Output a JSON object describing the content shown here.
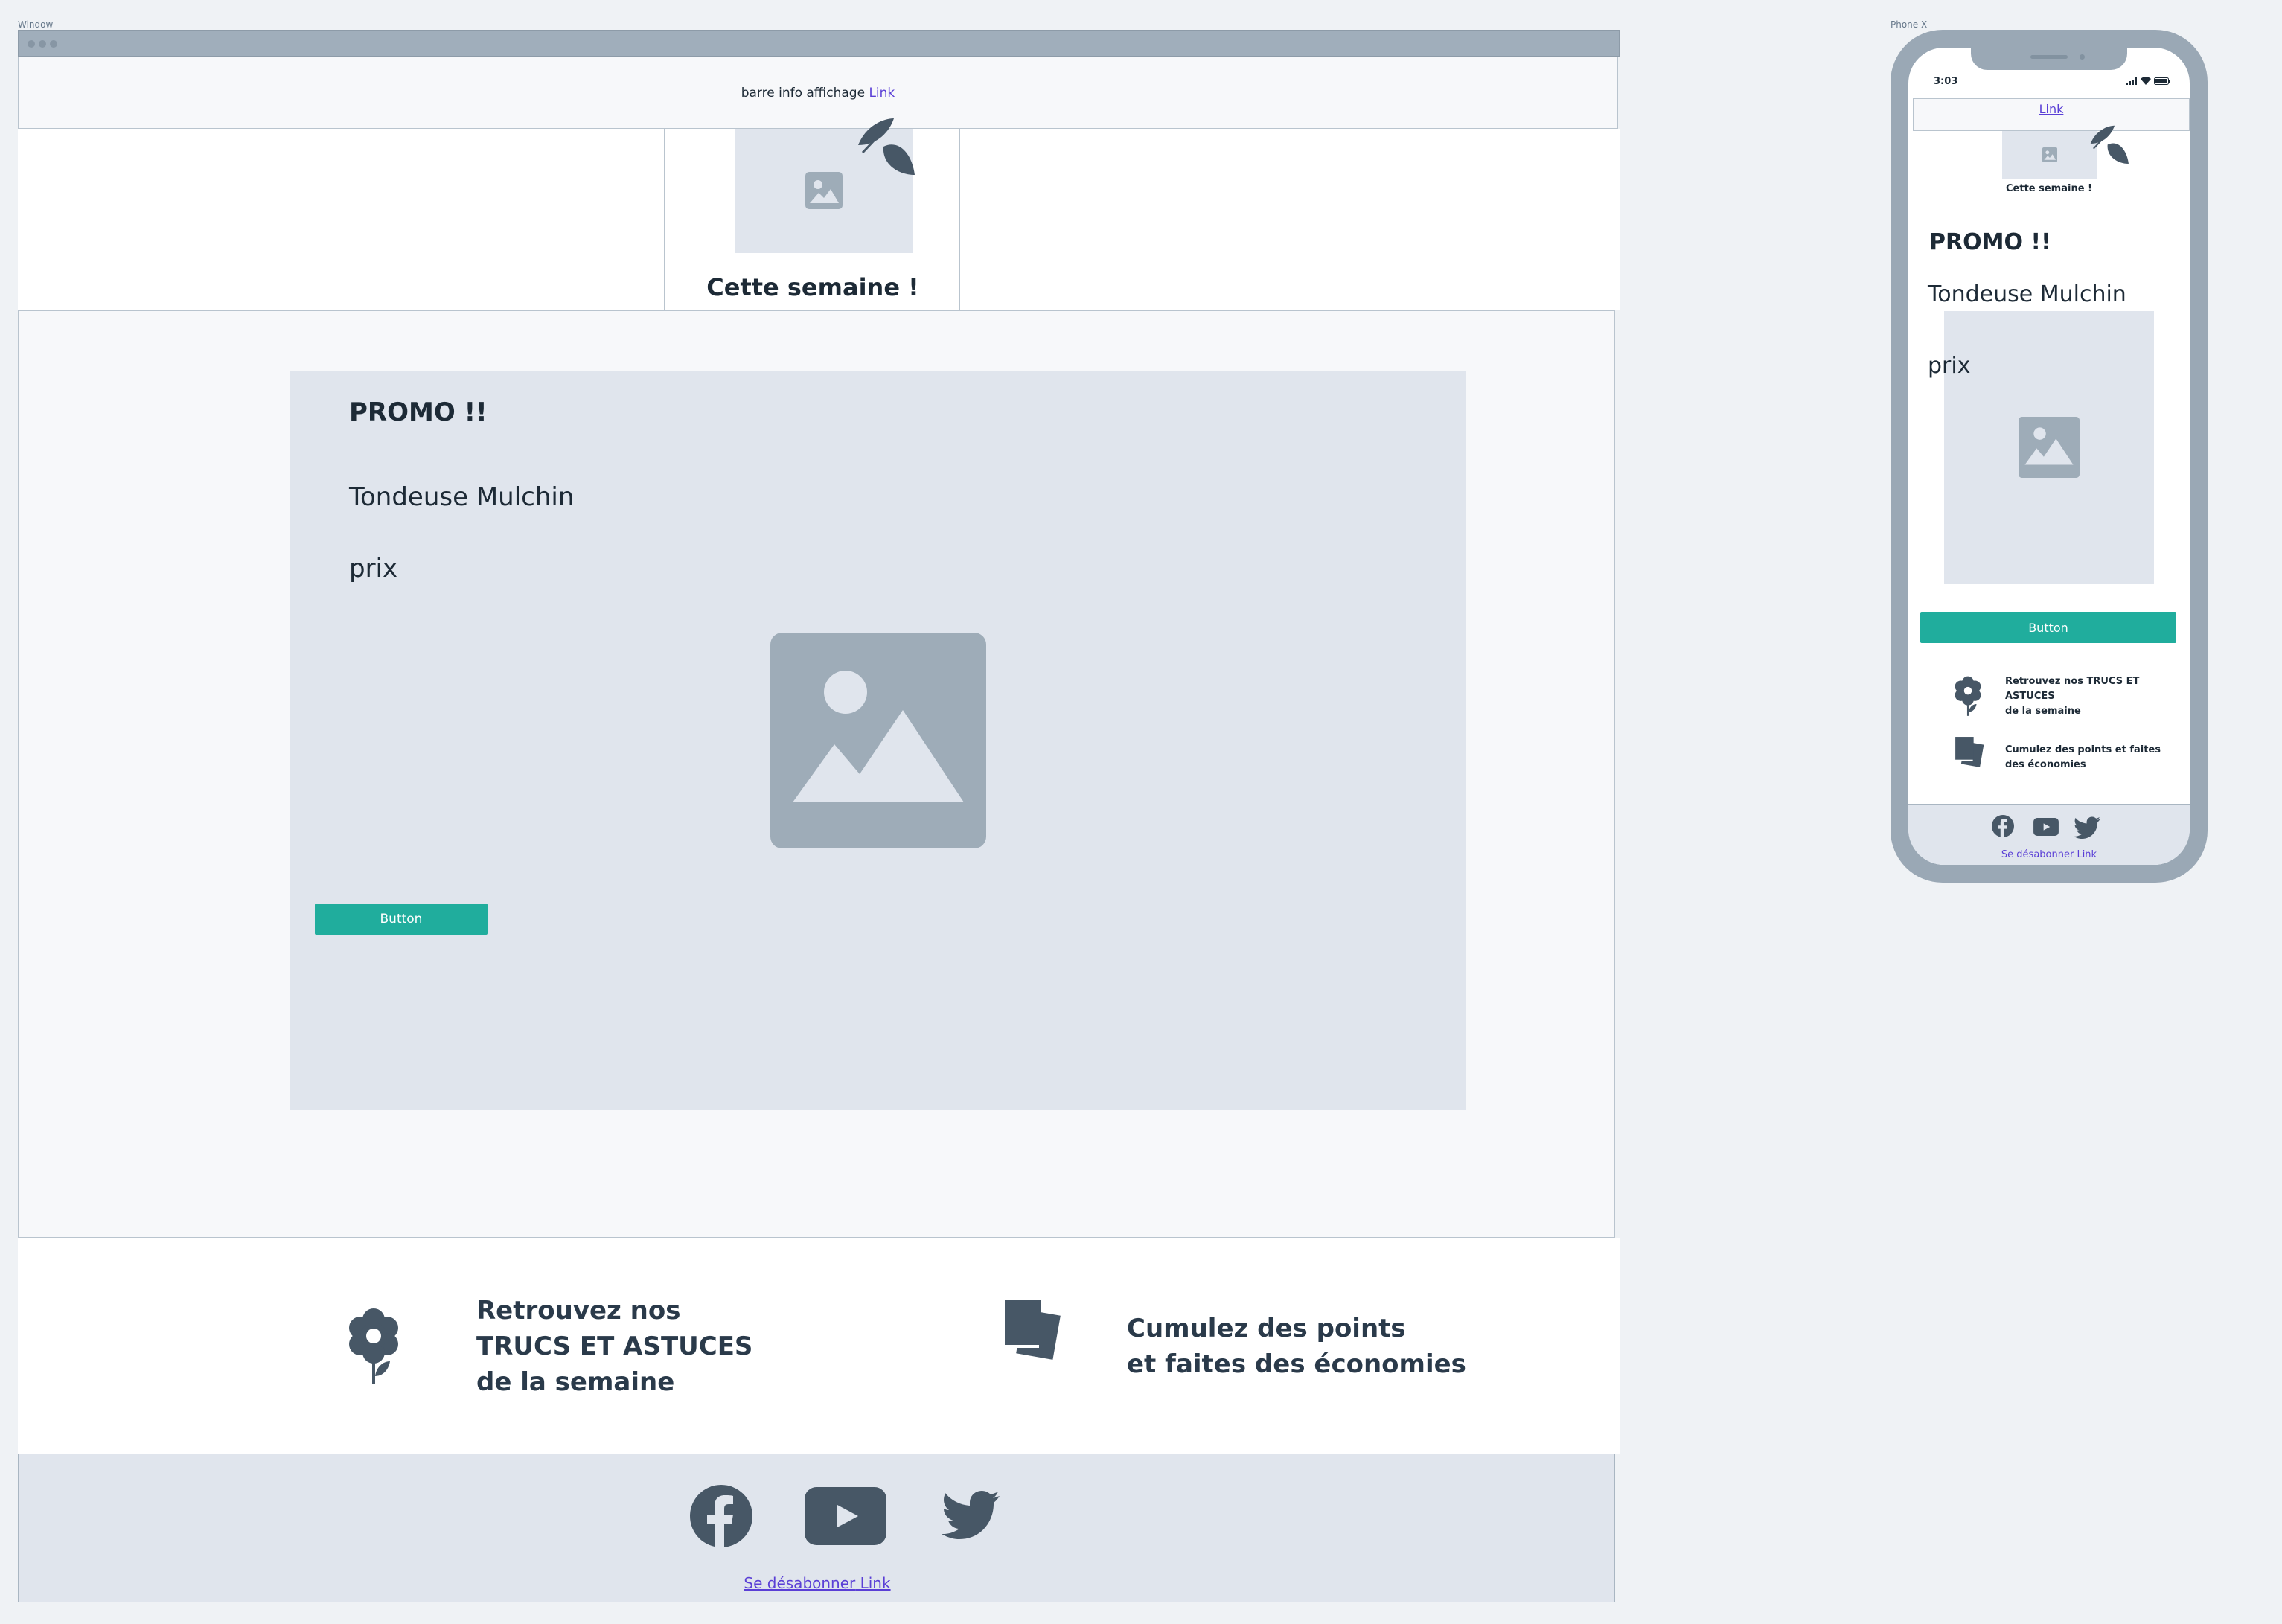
{
  "frames": {
    "desktop_label": "Window",
    "mobile_label": "Phone X"
  },
  "desktop": {
    "info_bar": {
      "text": "barre info affichage",
      "link": "Link"
    },
    "hero": {
      "title": "Cette semaine !"
    },
    "promo": {
      "heading": "PROMO !!",
      "product": "Tondeuse Mulchin",
      "price": "prix",
      "button": "Button"
    },
    "features": {
      "tips": [
        "Retrouvez nos",
        "TRUCS ET ASTUCES",
        "de la semaine"
      ],
      "points": [
        "Cumulez des points",
        "et faites des économies"
      ]
    },
    "footer": {
      "unsubscribe_text": "Se désabonner",
      "unsubscribe_link": "Link"
    }
  },
  "mobile": {
    "status": {
      "time": "3:03"
    },
    "info_link": "Link",
    "hero_title": "Cette semaine !",
    "promo": {
      "heading": "PROMO !!",
      "product": "Tondeuse Mulchin",
      "price": "prix",
      "button": "Button"
    },
    "features": {
      "tips": [
        "Retrouvez nos TRUCS ET ASTUCES",
        "de la semaine"
      ],
      "points": [
        "Cumulez des points et faites",
        "des économies"
      ]
    },
    "footer": {
      "unsubscribe": "Se désabonner Link"
    }
  },
  "icons": {
    "leaf": "leaf-icon",
    "image": "image-placeholder-icon",
    "flower": "flower-icon",
    "cards": "cards-icon",
    "facebook": "facebook-icon",
    "youtube": "youtube-icon",
    "twitter": "twitter-icon"
  },
  "colors": {
    "accent": "#20ad9d",
    "link": "#5a3fd6",
    "placeholder": "#e0e5ed",
    "icon_dark": "#475766",
    "window_chrome": "#a0aebb"
  }
}
